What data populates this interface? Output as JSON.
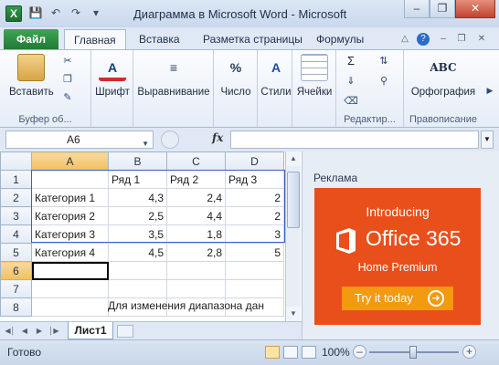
{
  "window": {
    "title": "Диаграмма в Microsoft Word  -  Microsoft Excel S...",
    "app_icon": "X",
    "qat_icons": [
      "save-icon",
      "undo-icon",
      "redo-icon",
      "customize-icon"
    ],
    "controls": [
      "minimize-icon",
      "restore-icon",
      "close-icon"
    ]
  },
  "tabs": {
    "file": "Файл",
    "items": [
      "Главная",
      "Вставка",
      "Разметка страницы",
      "Формулы"
    ],
    "active": "Главная"
  },
  "ribbon": {
    "paste_label": "Вставить",
    "clipboard_group": "Буфер об...",
    "font_label": "Шрифт",
    "alignment_label": "Выравнивание",
    "number_label": "Число",
    "styles_label": "Стили",
    "cells_label": "Ячейки",
    "editing_group": "Редактир...",
    "spelling_label": "Орфография",
    "spelling_icon_text": "ABC",
    "proofing_group": "Правописание",
    "number_icon": "%",
    "sigma_icon": "Σ"
  },
  "formula_bar": {
    "name_box": "A6",
    "fx": "fx",
    "value": ""
  },
  "grid": {
    "columns": [
      "A",
      "B",
      "C",
      "D"
    ],
    "active_col": "A",
    "active_row": "6",
    "rows": [
      {
        "n": "1",
        "cells": [
          "",
          "Ряд 1",
          "Ряд 2",
          "Ряд 3"
        ]
      },
      {
        "n": "2",
        "cells": [
          "Категория 1",
          "4,3",
          "2,4",
          "2"
        ]
      },
      {
        "n": "3",
        "cells": [
          "Категория 2",
          "2,5",
          "4,4",
          "2"
        ]
      },
      {
        "n": "4",
        "cells": [
          "Категория 3",
          "3,5",
          "1,8",
          "3"
        ]
      },
      {
        "n": "5",
        "cells": [
          "Категория 4",
          "4,5",
          "2,8",
          "5"
        ]
      },
      {
        "n": "6",
        "cells": [
          "",
          "",
          "",
          ""
        ]
      },
      {
        "n": "7",
        "cells": [
          "",
          "",
          "",
          ""
        ]
      },
      {
        "n": "8",
        "cells": [
          "",
          "",
          "",
          ""
        ]
      }
    ],
    "note": "Для изменения диапазона дан"
  },
  "sheets": {
    "active": "Лист1"
  },
  "ad": {
    "label": "Реклама",
    "intro": "Introducing",
    "product": "Office 365",
    "edition": "Home Premium",
    "cta": "Try it today",
    "bg_color": "#e94f1b",
    "cta_color": "#f39a11"
  },
  "status": {
    "ready": "Готово",
    "zoom": "100%"
  }
}
